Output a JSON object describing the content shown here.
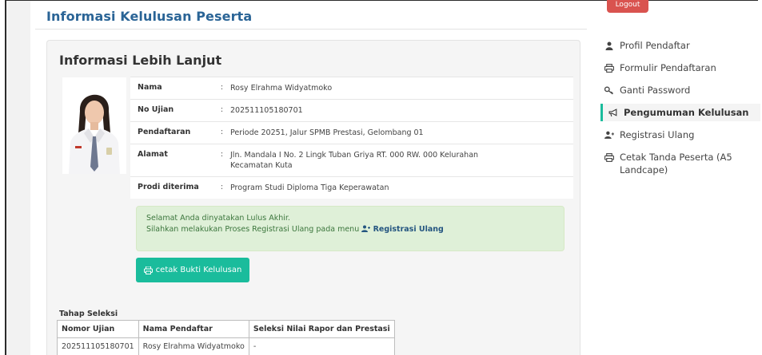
{
  "header": {
    "page_title": "Informasi Kelulusan Peserta",
    "logout_label": "Logout"
  },
  "panel": {
    "title": "Informasi Lebih Lanjut",
    "rows": [
      {
        "label": "Nama",
        "sep": ":",
        "value": "Rosy Elrahma Widyatmoko"
      },
      {
        "label": "No Ujian",
        "sep": ":",
        "value": "202511105180701"
      },
      {
        "label": "Pendaftaran",
        "sep": ":",
        "value": "Periode 20251, Jalur SPMB Prestasi, Gelombang 01"
      },
      {
        "label": "Alamat",
        "sep": ":",
        "value": "Jln. Mandala I No. 2 Lingk Tuban Griya RT. 000 RW. 000 Kelurahan Kecamatan Kuta"
      },
      {
        "label": "Prodi diterima",
        "sep": ":",
        "value": "Program Studi Diploma Tiga Keperawatan"
      }
    ],
    "alert": {
      "line1": "Selamat Anda dinyatakan Lulus Akhir.",
      "line2": "Silahkan melakukan Proses Registrasi Ulang pada menu",
      "link": "Registrasi Ulang",
      "link_icon": "user-plus-icon",
      "color": "#dff0d8"
    },
    "cetak_button": {
      "label": "cetak Bukti Kelulusan",
      "icon": "printer-icon",
      "color": "#1abc9c"
    },
    "tahap": {
      "label": "Tahap Seleksi",
      "headers": [
        "Nomor Ujian",
        "Nama Pendaftar",
        "Seleksi Nilai Rapor dan Prestasi"
      ],
      "rows": [
        [
          "202511105180701",
          "Rosy Elrahma Widyatmoko",
          "-"
        ]
      ]
    }
  },
  "side_menu": {
    "items": [
      {
        "label": "Profil Pendaftar",
        "icon": "user-icon"
      },
      {
        "label": "Formulir Pendaftaran",
        "icon": "printer-icon"
      },
      {
        "label": "Ganti Password",
        "icon": "key-icon"
      },
      {
        "label": "Pengumuman Kelulusan",
        "icon": "bullhorn-icon",
        "active": true
      },
      {
        "label": "Registrasi Ulang",
        "icon": "user-plus-icon"
      },
      {
        "label": "Cetak Tanda Peserta (A5 Landcape)",
        "icon": "printer-icon"
      }
    ],
    "accent_color": "#1abc9c"
  }
}
